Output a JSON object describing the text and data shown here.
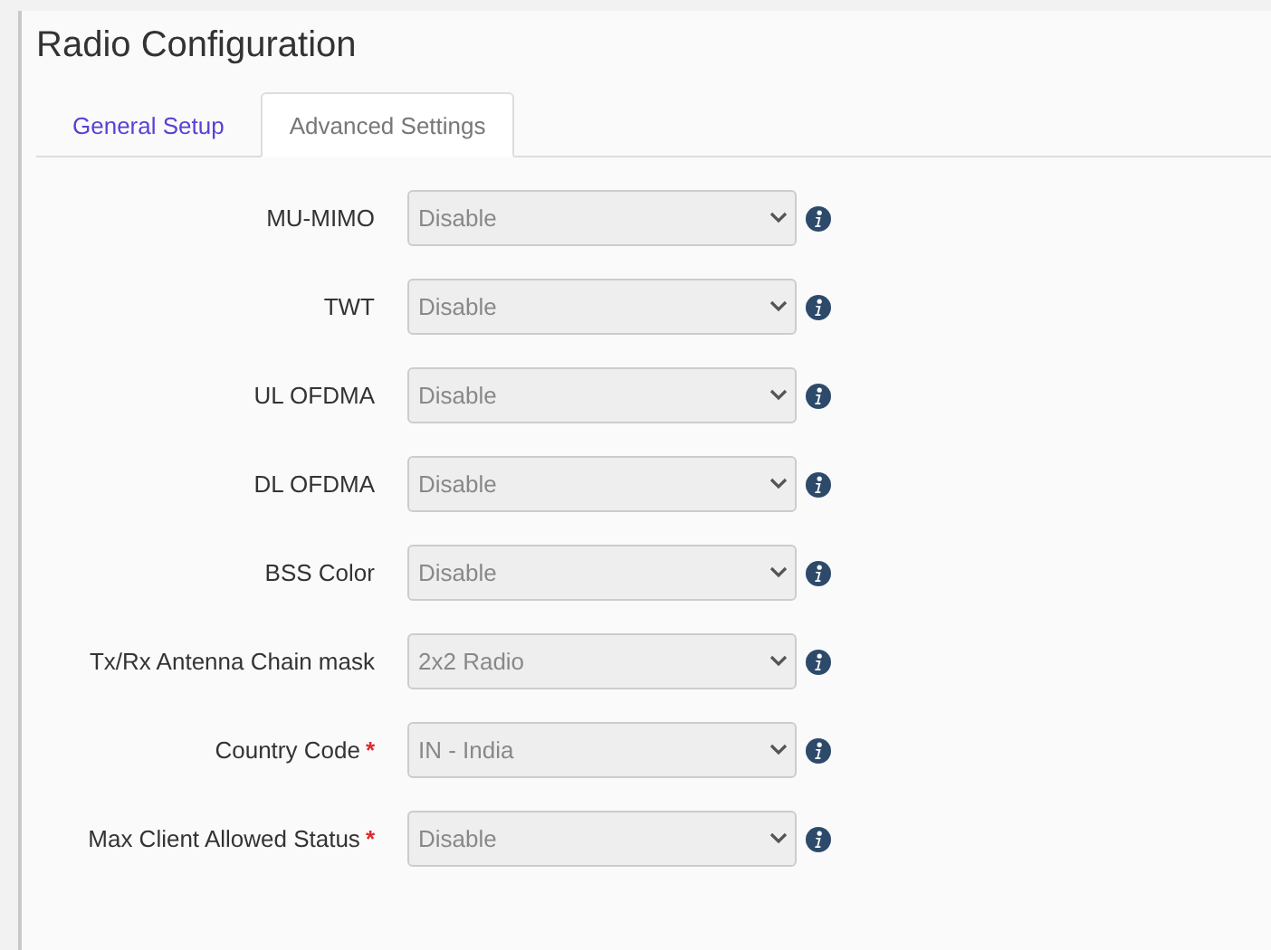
{
  "title": "Radio Configuration",
  "tabs": [
    {
      "label": "General Setup",
      "selected": false
    },
    {
      "label": "Advanced Settings",
      "selected": true
    }
  ],
  "fields": [
    {
      "label": "MU-MIMO",
      "value": "Disable"
    },
    {
      "label": "TWT",
      "value": "Disable"
    },
    {
      "label": "UL OFDMA",
      "value": "Disable"
    },
    {
      "label": "DL OFDMA",
      "value": "Disable"
    },
    {
      "label": "BSS Color",
      "value": "Disable"
    },
    {
      "label": "Tx/Rx Antenna Chain mask",
      "value": "2x2 Radio"
    },
    {
      "label": "Country Code",
      "required_mark": "*",
      "value": "IN - India"
    },
    {
      "label": "Max Client Allowed Status",
      "required_mark": "*",
      "value": "Disable"
    }
  ]
}
